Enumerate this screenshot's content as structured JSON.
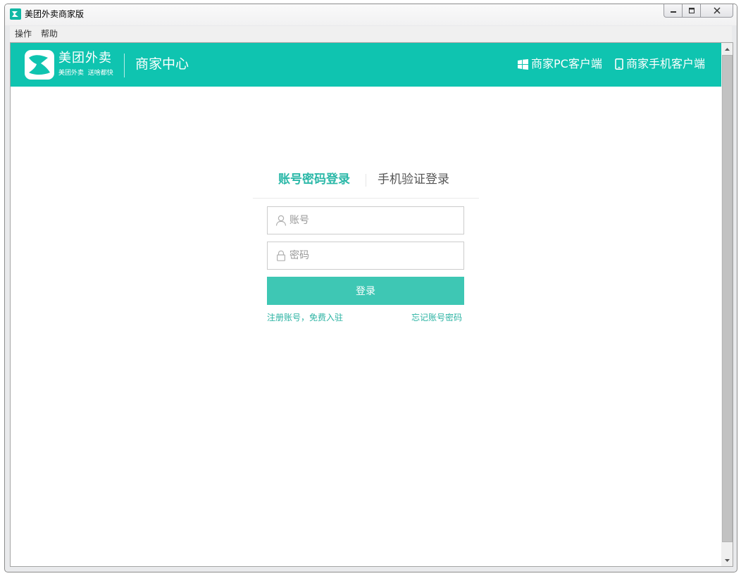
{
  "window": {
    "title": "美团外卖商家版"
  },
  "menu": {
    "items": [
      "操作",
      "帮助"
    ]
  },
  "header": {
    "brand_name": "美团外卖",
    "brand_slogan": "美团外卖  送啥都快",
    "title": "商家中心",
    "pc_client_label": "商家PC客户端",
    "mobile_client_label": "商家手机客户端"
  },
  "login": {
    "tabs": [
      {
        "label": "账号密码登录",
        "active": true
      },
      {
        "label": "手机验证登录",
        "active": false
      }
    ],
    "account_placeholder": "账号",
    "password_placeholder": "密码",
    "submit_label": "登录",
    "register_link": "注册账号，免费入驻",
    "forgot_link": "忘记账号密码"
  },
  "icons": {
    "app": "meituan-app-icon",
    "pc": "windows-icon",
    "mobile": "phone-icon",
    "account": "user-icon",
    "password": "lock-icon"
  },
  "colors": {
    "brand": "#0fc4b0",
    "button": "#3ec7b4",
    "link": "#2cb3a3"
  }
}
